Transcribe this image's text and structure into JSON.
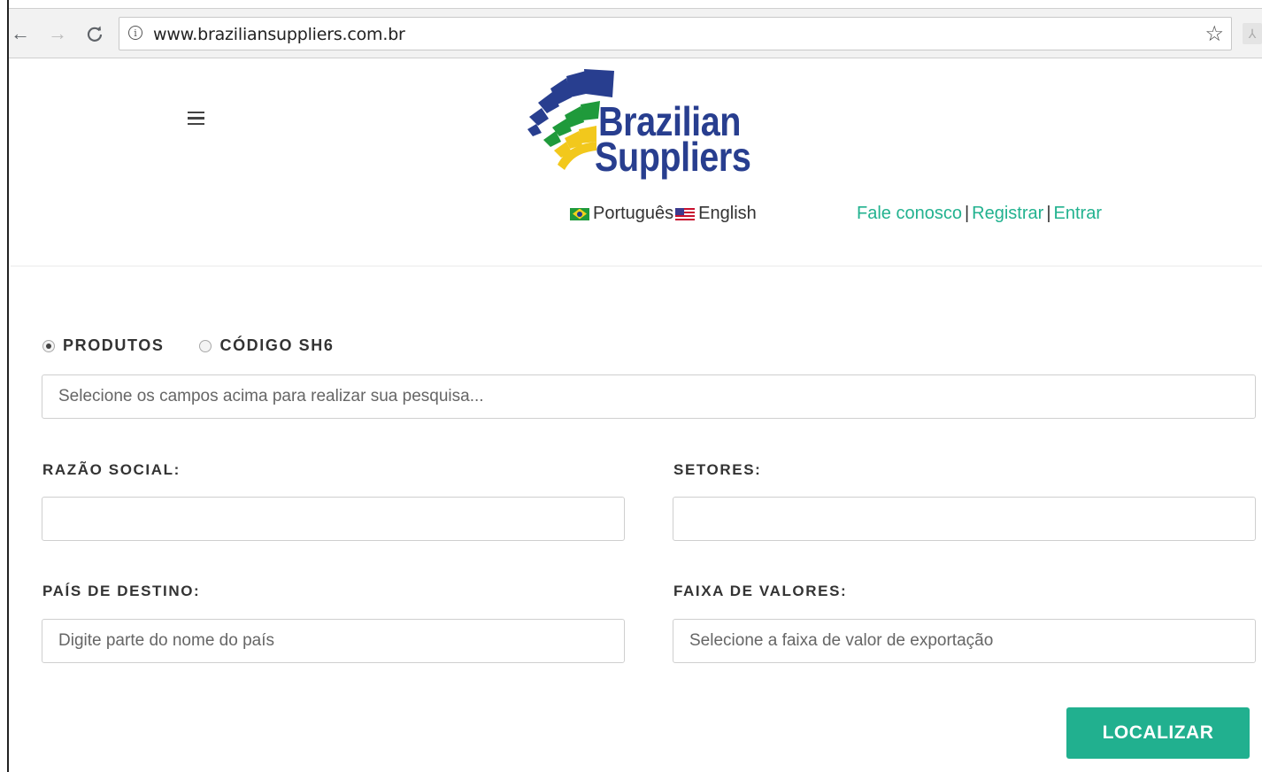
{
  "browser": {
    "url": "www.braziliansuppliers.com.br",
    "back_icon": "arrow-left-icon",
    "forward_icon": "arrow-right-icon",
    "reload_icon": "reload-icon",
    "info_icon": "info-icon",
    "star_icon": "star-icon"
  },
  "header": {
    "logo_line1": "Brazilian",
    "logo_line2": "Suppliers",
    "menu_icon": "hamburger-menu-icon",
    "languages": [
      {
        "label": "Português",
        "flag": "brazil-flag-icon"
      },
      {
        "label": "English",
        "flag": "usa-flag-icon"
      }
    ],
    "links": {
      "contact": "Fale conosco",
      "register": "Registrar",
      "login": "Entrar",
      "separator": "|"
    }
  },
  "search": {
    "options": [
      {
        "label": "PRODUTOS",
        "checked": true
      },
      {
        "label": "CÓDIGO SH6",
        "checked": false
      }
    ],
    "main_placeholder": "Selecione os campos acima para realizar sua pesquisa...",
    "fields": {
      "razao_social": {
        "label": "RAZÃO SOCIAL:",
        "placeholder": ""
      },
      "setores": {
        "label": "SETORES:",
        "placeholder": ""
      },
      "pais_destino": {
        "label": "PAÍS DE DESTINO:",
        "placeholder": "Digite parte do nome do país"
      },
      "faixa_valores": {
        "label": "FAIXA DE VALORES:",
        "placeholder": "Selecione a faixa de valor de exportação"
      }
    },
    "submit_label": "LOCALIZAR"
  },
  "colors": {
    "accent": "#21b08f",
    "link": "#22b28f",
    "logo_blue": "#283e8f",
    "logo_green": "#1f9a3b",
    "logo_yellow": "#f2c81c"
  }
}
